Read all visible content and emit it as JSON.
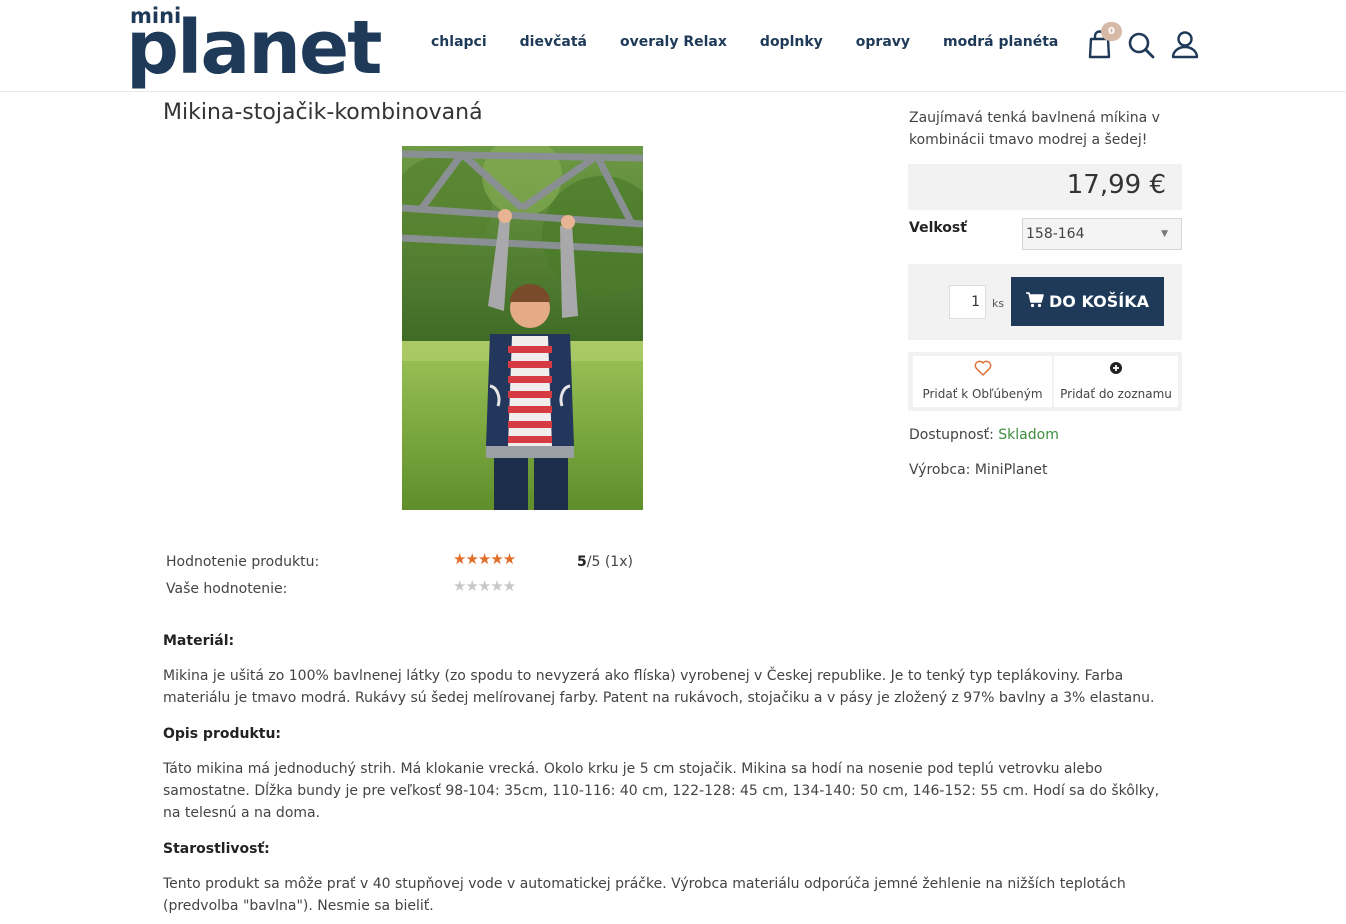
{
  "header": {
    "logo_small": "mini",
    "logo_big": "planet",
    "nav": [
      "chlapci",
      "dievčatá",
      "overaly Relax",
      "doplnky",
      "opravy",
      "modrá planéta"
    ],
    "cart_count": "0"
  },
  "product": {
    "title": "Mikina-stojačik-kombinovaná",
    "short_description": "Zaujímavá tenká bavlnená míkina v kombinácii tmavo modrej a šedej!",
    "price": "17,99 €",
    "size_label": "Velkosť",
    "size_selected": "158-164",
    "quantity": "1",
    "quantity_unit": "ks",
    "add_to_cart_label": "DO KOŠÍKA",
    "favorite_label": "Pridať k Obľúbeným",
    "list_label": "Pridať do zoznamu",
    "availability_label": "Dostupnosť:",
    "availability_value": "Skladom",
    "manufacturer_label": "Výrobca:",
    "manufacturer_value": "MiniPlanet"
  },
  "rating": {
    "product_label": "Hodnotenie produktu:",
    "your_label": "Vaše hodnotenie:",
    "score_value": "5",
    "score_rest": "/5 (1x)",
    "stars_filled": 5,
    "stars_total": 5
  },
  "sections": [
    {
      "heading": "Materiál:",
      "text": "Mikina je ušitá zo 100% bavlnenej látky (zo spodu to nevyzerá ako flíska) vyrobenej v Českej republike. Je to tenký typ teplákoviny. Farba materiálu je tmavo modrá. Rukávy sú šedej melírovanej farby. Patent na rukávoch, stojačiku a v pásy je zložený z 97% bavlny a 3% elastanu."
    },
    {
      "heading": "Opis produktu:",
      "text": "Táto mikina má jednoduchý strih. Má klokanie vrecká. Okolo krku je 5 cm stojačik. Mikina sa hodí na nosenie pod teplú vetrovku alebo samostatne. Dĺžka bundy je pre veľkosť 98-104: 35cm, 110-116: 40 cm, 122-128: 45 cm, 134-140: 50 cm, 146-152: 55 cm. Hodí sa do škôlky, na telesnú a na doma."
    },
    {
      "heading": "Starostlivosť:",
      "text": "Tento produkt sa môže prať v 40 stupňovej vode v automatickej práčke. Výrobca materiálu odporúča jemné žehlenie na nižších teplotách (predvolba \"bavlna\"). Nesmie sa bieliť."
    }
  ],
  "colors": {
    "brand": "#1e3a58",
    "badge": "#d7b9a7",
    "star": "#e06d2a",
    "in_stock": "#3d8e3d"
  },
  "icons": [
    "shopping-bag-icon",
    "search-icon",
    "user-icon",
    "cart-icon",
    "heart-icon",
    "plus-circle-icon"
  ]
}
